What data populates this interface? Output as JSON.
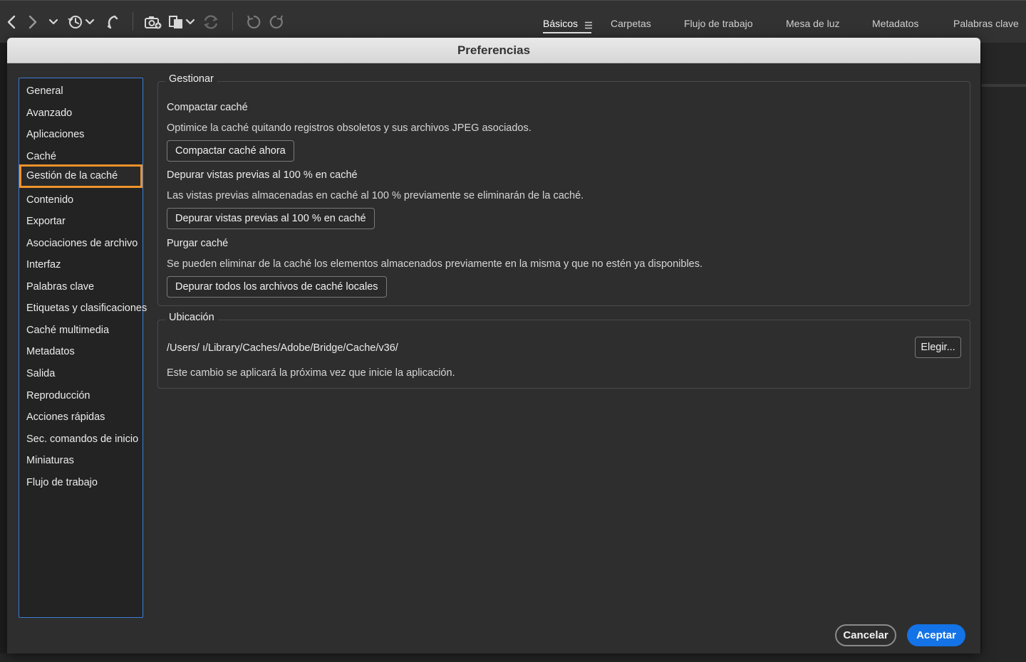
{
  "toolbar": {
    "icons": [
      "back-icon",
      "forward-icon",
      "recent-folder-dropdown-icon",
      "history-icon",
      "boomerang-icon",
      "camera-import-icon",
      "refine-icon",
      "rotate-icon",
      "rotate-left-icon",
      "rotate-right-icon"
    ],
    "workspace_tabs": [
      {
        "label": "Básicos",
        "active": true
      },
      {
        "label": "Carpetas"
      },
      {
        "label": "Flujo de trabajo"
      },
      {
        "label": "Mesa de luz"
      },
      {
        "label": "Metadatos"
      },
      {
        "label": "Palabras clave"
      }
    ]
  },
  "dialog": {
    "title": "Preferencias",
    "sidebar": {
      "items": [
        {
          "label": "General"
        },
        {
          "label": "Avanzado"
        },
        {
          "label": "Aplicaciones"
        },
        {
          "label": "Caché"
        },
        {
          "label": "Gestión de la caché",
          "selected": true
        },
        {
          "label": "Contenido"
        },
        {
          "label": "Exportar"
        },
        {
          "label": "Asociaciones de archivo"
        },
        {
          "label": "Interfaz"
        },
        {
          "label": "Palabras clave"
        },
        {
          "label": "Etiquetas y clasificaciones"
        },
        {
          "label": "Caché multimedia"
        },
        {
          "label": "Metadatos"
        },
        {
          "label": "Salida"
        },
        {
          "label": "Reproducción"
        },
        {
          "label": "Acciones rápidas"
        },
        {
          "label": "Sec. comandos de inicio"
        },
        {
          "label": "Miniaturas"
        },
        {
          "label": "Flujo de trabajo"
        }
      ]
    },
    "manage": {
      "legend": "Gestionar",
      "compact_title": "Compactar caché",
      "compact_desc": "Optimice la caché quitando registros obsoletos y sus archivos JPEG asociados.",
      "compact_button": "Compactar caché ahora",
      "purge100_title": "Depurar vistas previas al 100 % en caché",
      "purge100_desc": "Las vistas previas almacenadas en caché al 100 % previamente se eliminarán de la caché.",
      "purge100_button": "Depurar vistas previas al 100 % en caché",
      "purge_title": "Purgar caché",
      "purge_desc": "Se pueden eliminar de la caché los elementos almacenados previamente en la misma y que no estén ya disponibles.",
      "purge_button": "Depurar todos los archivos de caché locales"
    },
    "location": {
      "legend": "Ubicación",
      "path": "/Users/           ı/Library/Caches/Adobe/Bridge/Cache/v36/",
      "choose_button": "Elegir...",
      "note": "Este cambio se aplicará la próxima vez que inicie la aplicación."
    },
    "cancel_button": "Cancelar",
    "ok_button": "Aceptar"
  },
  "colors": {
    "accent": "#1473e6",
    "selection_outline": "#f0922a",
    "sidebar_border": "#3f7bd6"
  }
}
